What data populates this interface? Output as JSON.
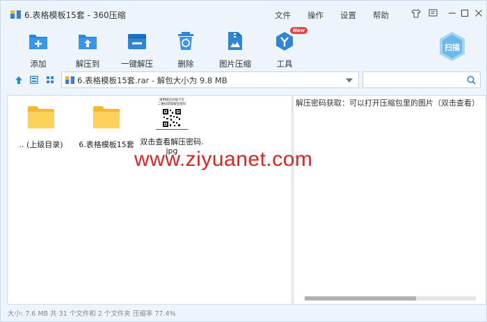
{
  "window": {
    "title": "6.表格模板15套 - 360压缩",
    "menus": [
      "文件",
      "操作",
      "设置",
      "帮助"
    ]
  },
  "toolbar": {
    "items": [
      {
        "label": "添加",
        "icon": "add-icon"
      },
      {
        "label": "解压到",
        "icon": "extract-to-icon"
      },
      {
        "label": "一键解压",
        "icon": "one-click-extract-icon"
      },
      {
        "label": "删除",
        "icon": "delete-icon"
      },
      {
        "label": "图片压缩",
        "icon": "image-compress-icon"
      },
      {
        "label": "工具",
        "icon": "tools-icon",
        "badge": "New"
      }
    ],
    "scan_label": "扫描"
  },
  "address": {
    "path": "6.表格模板15套.rar - 解包大小为 9.8 MB",
    "search_placeholder": ""
  },
  "files": [
    {
      "name": ".. (上级目录)",
      "type": "folder"
    },
    {
      "name": "6.表格模板15套",
      "type": "folder"
    },
    {
      "name": "双击查看解压密码.jpg",
      "type": "image",
      "thumb_line1": "请用微信扫描下方",
      "thumb_line2": "二维码获取解压密码"
    }
  ],
  "preview": {
    "text": "解压密码获取：可以打开压缩包里的图片（双击查看）"
  },
  "status": {
    "text": "大小: 7.6 MB 共 31 个文件和 2 个文件夹 压缩率 77.4%"
  },
  "watermark": {
    "text": "www.ziyuanet.com"
  },
  "colors": {
    "accent": "#2f86d6",
    "folder": "#f5c542",
    "watermark": "#e3211f"
  }
}
